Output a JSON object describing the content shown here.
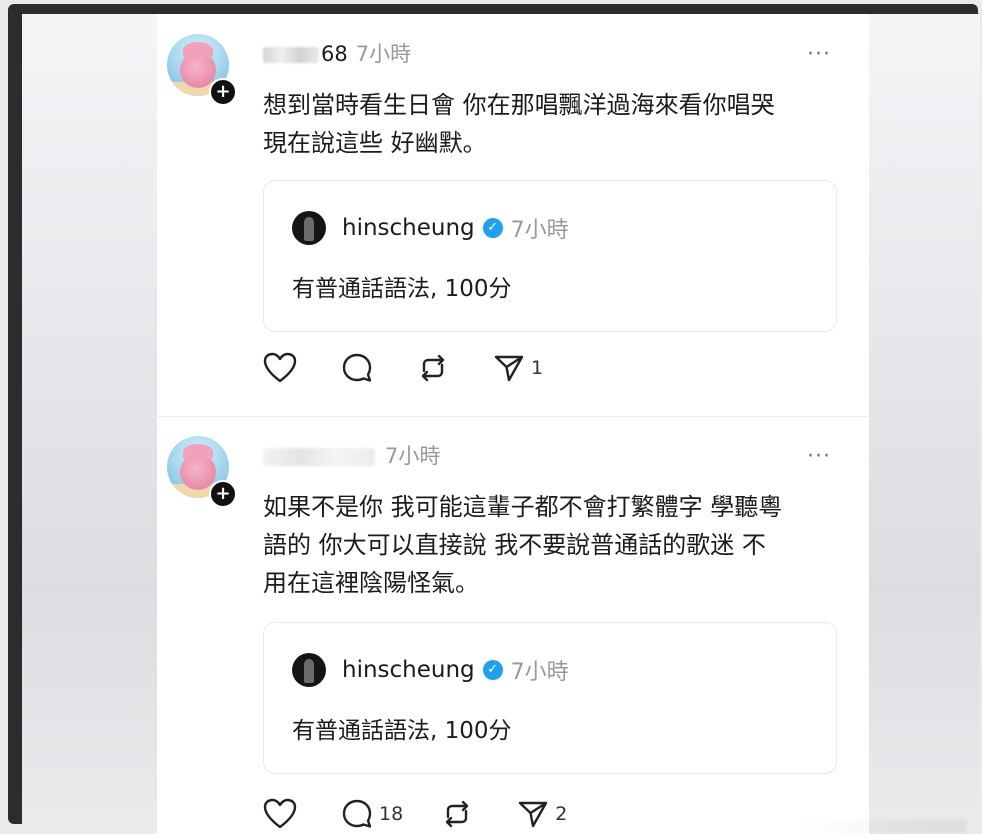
{
  "posts": [
    {
      "username_visible": "68",
      "time": "7小時",
      "more_label": "···",
      "body_lines": [
        "想到當時看生日會 你在那唱飄洋過海來看你唱哭",
        "現在說這些 好幽默。"
      ],
      "quote": {
        "username": "hinscheung",
        "time": "7小時",
        "text": "有普通話語法, 100分"
      },
      "actions": {
        "like_count": "",
        "reply_count": "",
        "repost_count": "",
        "share_count": "1"
      }
    },
    {
      "username_visible": "",
      "time": "7小時",
      "more_label": "···",
      "body_lines": [
        "如果不是你 我可能這輩子都不會打繁體字 學聽粵",
        "語的 你大可以直接說 我不要說普通話的歌迷 不",
        "用在這裡陰陽怪氣。"
      ],
      "quote": {
        "username": "hinscheung",
        "time": "7小時",
        "text": "有普通話語法, 100分"
      },
      "actions": {
        "like_count": "",
        "reply_count": "18",
        "repost_count": "",
        "share_count": "2"
      }
    }
  ],
  "icons": {
    "follow": "plus-icon",
    "verified": "verified-icon",
    "like": "heart-icon",
    "reply": "comment-icon",
    "repost": "repost-icon",
    "share": "send-icon"
  },
  "colors": {
    "verified": "#1fa1f1",
    "muted": "#999999",
    "text": "#1b1b1b"
  }
}
